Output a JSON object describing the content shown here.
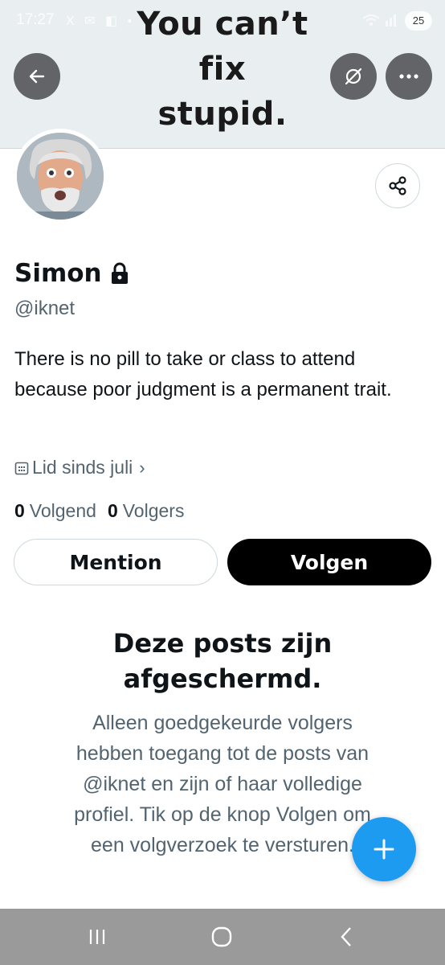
{
  "status_bar": {
    "time": "17:27",
    "icons": "X ✉ ◧ •",
    "battery": "25"
  },
  "banner": {
    "lines": [
      "You can’t",
      "fix",
      "stupid."
    ]
  },
  "header": {
    "back_icon": "arrow-left-icon",
    "hide_icon": "eye-slash-icon",
    "more_icon": "more-horizontal-icon",
    "share_icon": "share-icon"
  },
  "profile": {
    "name": "Simon",
    "handle": "@iknet",
    "bio": "There is no pill to take or class to attend because poor judgment is a permanent trait.",
    "joined": "Lid sinds juli",
    "following_count": "0",
    "following_label": "Volgend",
    "followers_count": "0",
    "followers_label": "Volgers"
  },
  "actions": {
    "mention_label": "Mention",
    "follow_label": "Volgen"
  },
  "protected": {
    "title_lines": [
      "Deze posts zijn",
      "afgeschermd."
    ],
    "body_lines": [
      "Alleen goedgekeurde volgers",
      "hebben toegang tot de posts van",
      "@iknet en zijn of haar volledige",
      "profiel. Tik op de knop Volgen om",
      "een volgverzoek te versturen."
    ]
  },
  "colors": {
    "accent": "#1d9bf0",
    "follow_button": "#000000",
    "secondary_text": "#536471",
    "nav_bar": "#9a9a9a"
  }
}
